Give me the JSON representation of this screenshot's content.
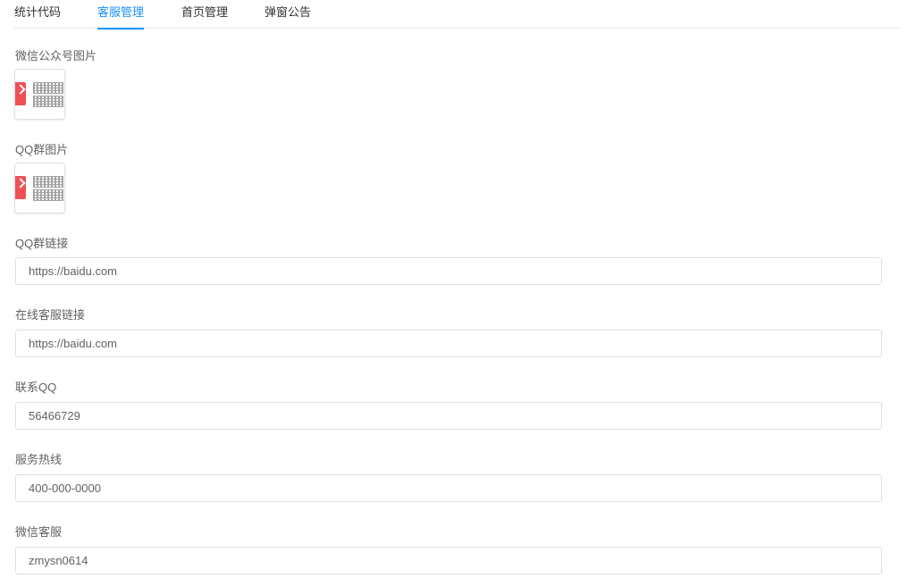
{
  "tabs": [
    {
      "label": "统计代码",
      "active": false
    },
    {
      "label": "客服管理",
      "active": true
    },
    {
      "label": "首页管理",
      "active": false
    },
    {
      "label": "弹窗公告",
      "active": false
    }
  ],
  "colors": {
    "accent": "#1890ff",
    "border": "#dcdfe6",
    "label": "#606266",
    "thumb_brand": "#f05056"
  },
  "fields": {
    "wechat_image": {
      "label": "微信公众号图片",
      "thumb_icon": "image-thumbnail-icon"
    },
    "qq_image": {
      "label": "QQ群图片",
      "thumb_icon": "image-thumbnail-icon"
    },
    "qq_link": {
      "label": "QQ群链接",
      "value": "https://baidu.com"
    },
    "service_link": {
      "label": "在线客服链接",
      "value": "https://baidu.com"
    },
    "contact_qq": {
      "label": "联系QQ",
      "value": "56466729"
    },
    "hotline": {
      "label": "服务热线",
      "value": "400-000-0000"
    },
    "wechat_service": {
      "label": "微信客服",
      "value": "zmysn0614"
    }
  }
}
